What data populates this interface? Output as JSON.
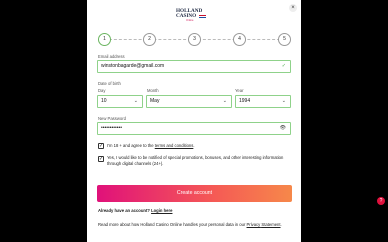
{
  "logo": {
    "line1": "HOLLAND",
    "line2": "CASINO",
    "line3": "Online"
  },
  "close_glyph": "×",
  "steps": [
    "1",
    "2",
    "3",
    "4",
    "5"
  ],
  "email": {
    "label": "Email address",
    "value": "winstonbagarde@gmail.com",
    "valid_glyph": "✓"
  },
  "dob": {
    "label": "Date of birth",
    "day_label": "Day",
    "day_value": "10",
    "month_label": "Month",
    "month_value": "May",
    "year_label": "Year",
    "year_value": "1994",
    "chevron_glyph": "⌄"
  },
  "password": {
    "label": "New Password",
    "value": "••••••••••••",
    "eye_glyph": "👁"
  },
  "terms": {
    "text": "I'm 18 + and agree to the ",
    "link": "terms and conditions",
    "end": "."
  },
  "promotions": {
    "text": "Yes, I would like to be notified of special promotions, bonuses, and other interesting information through digital channels (24+)."
  },
  "create_button": "Create account",
  "login": {
    "text": "Already have an account? ",
    "link": "Login here"
  },
  "privacy": {
    "text": "Read more about how Holland Casino Online handles your personal data in our ",
    "link_a": "Privacy",
    "link_b": "Statement",
    "end": "."
  },
  "side_badge": "?",
  "colors": {
    "accent_start": "#e0117a",
    "accent_end": "#f6884a",
    "valid_green": "#8fd28a"
  }
}
